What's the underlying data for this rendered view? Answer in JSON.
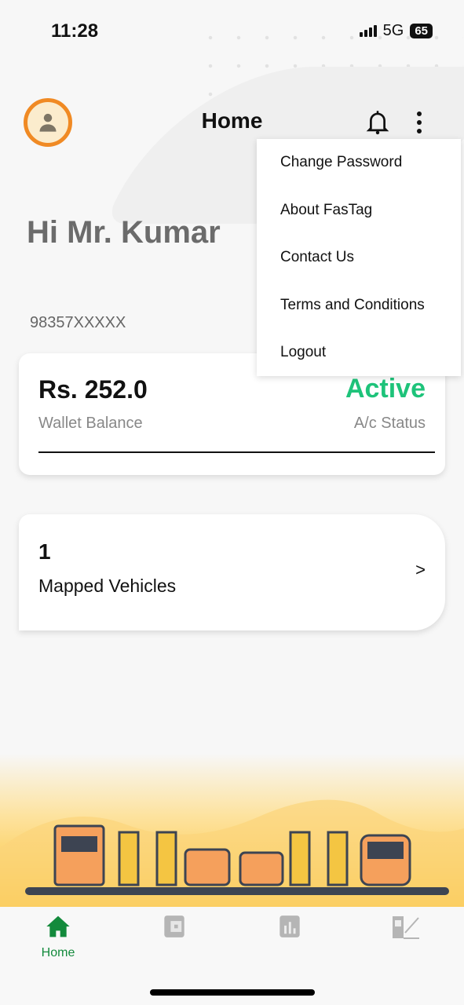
{
  "status_bar": {
    "time": "11:28",
    "network": "5G",
    "battery": "65"
  },
  "header": {
    "title": "Home",
    "avatar_icon": "person-icon",
    "bell_icon": "bell-icon",
    "menu_icon": "more-vertical-icon"
  },
  "greeting": "Hi Mr. Kumar",
  "phone": "98357XXXXX",
  "wallet": {
    "balance": "Rs. 252.0",
    "balance_label": "Wallet Balance",
    "status": "Active",
    "status_label": "A/c Status",
    "status_color": "#1ec37a"
  },
  "vehicles": {
    "count": "1",
    "label": "Mapped Vehicles",
    "arrow": ">"
  },
  "menu": {
    "items": [
      "Change Password",
      "About FasTag",
      "Contact Us",
      "Terms and Conditions",
      "Logout"
    ]
  },
  "bottom_nav": {
    "items": [
      {
        "label": "Home",
        "icon": "home-icon",
        "active": true
      },
      {
        "icon": "wallet-icon"
      },
      {
        "icon": "bar-chart-icon"
      },
      {
        "icon": "toll-booth-icon"
      }
    ],
    "active_color": "#138a3c",
    "inactive_color": "#b5b5b5"
  }
}
